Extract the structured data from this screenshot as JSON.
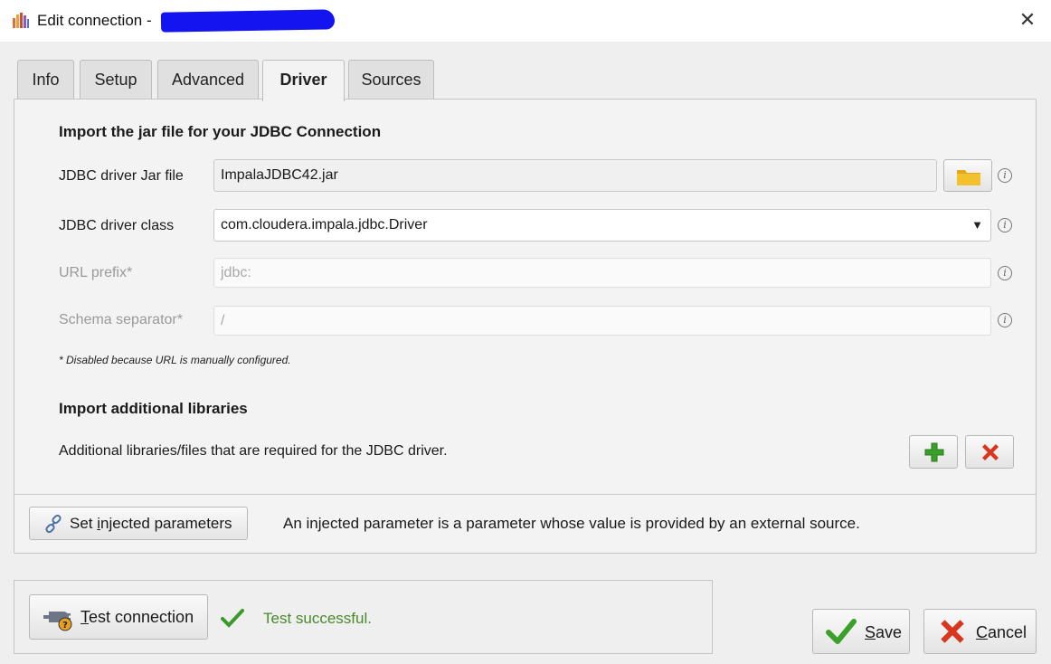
{
  "window": {
    "title": "Edit connection -",
    "close_icon": "close-icon"
  },
  "tabs": [
    {
      "label": "Info"
    },
    {
      "label": "Setup"
    },
    {
      "label": "Advanced"
    },
    {
      "label": "Driver",
      "active": true
    },
    {
      "label": "Sources"
    }
  ],
  "driver": {
    "section_title": "Import the jar file for your JDBC Connection",
    "jar_label": "JDBC driver Jar file",
    "jar_value": "ImpalaJDBC42.jar",
    "class_label": "JDBC driver class",
    "class_value": "com.cloudera.impala.jdbc.Driver",
    "url_label": "URL prefix*",
    "url_value": "jdbc:",
    "schema_label": "Schema separator*",
    "schema_value": "/",
    "disabled_note": "* Disabled because URL is manually configured.",
    "libs_title": "Import additional libraries",
    "libs_desc": "Additional libraries/files that are required for the JDBC driver."
  },
  "injected": {
    "button_label_pre": "Set ",
    "button_label_mnemonic": "i",
    "button_label_post": "njected parameters",
    "description": "An injected parameter is a parameter whose value is provided by an external source."
  },
  "test": {
    "button_mnemonic": "T",
    "button_rest": "est connection",
    "status": "Test successful."
  },
  "footer": {
    "save_mnemonic": "S",
    "save_rest": "ave",
    "cancel_mnemonic": "C",
    "cancel_rest": "ancel"
  },
  "colors": {
    "success_green": "#4a8a2a",
    "redaction_blue": "#1414f0",
    "folder_yellow": "#f2c12e"
  }
}
